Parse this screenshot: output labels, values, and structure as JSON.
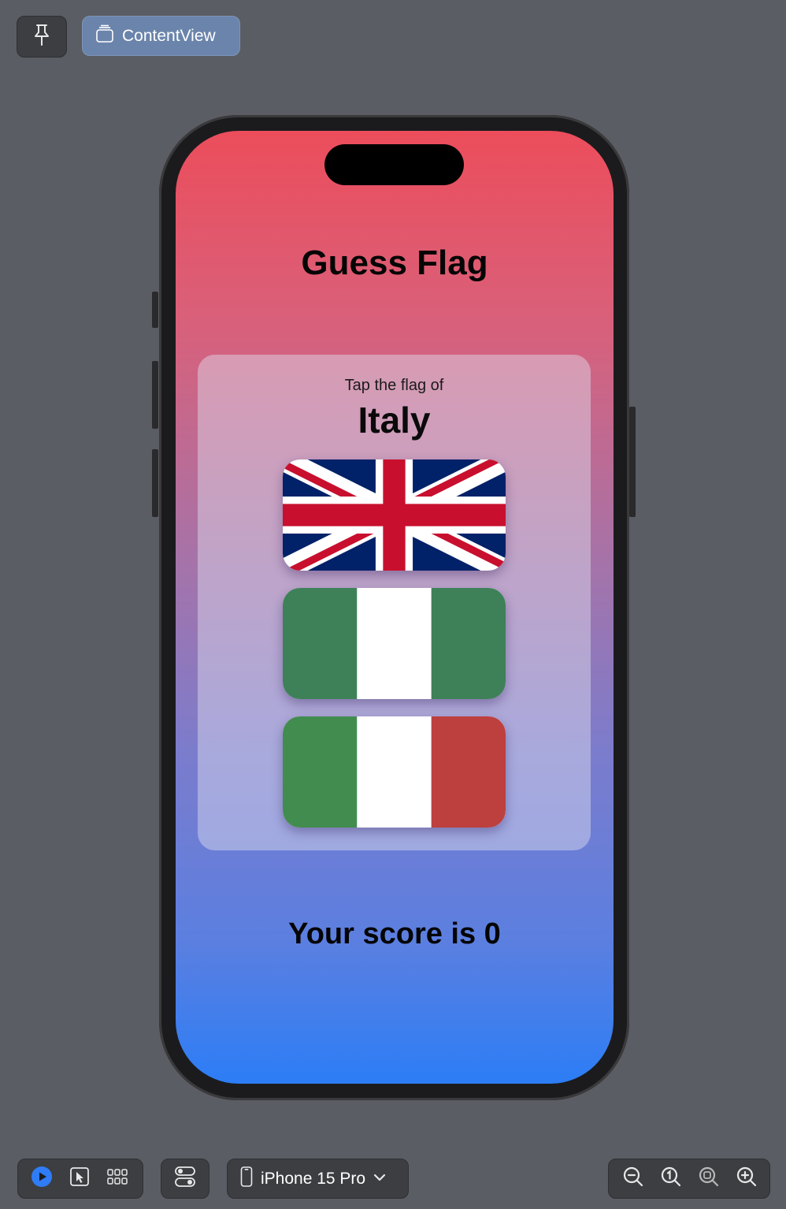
{
  "toolbar": {
    "preview_label": "ContentView"
  },
  "app": {
    "title": "Guess Flag",
    "prompt": "Tap the flag of",
    "country": "Italy",
    "flags": [
      {
        "icon": "uk-flag"
      },
      {
        "icon": "nigeria-flag"
      },
      {
        "icon": "italy-flag"
      }
    ],
    "score_text": "Your score is 0"
  },
  "bottom_toolbar": {
    "device_name": "iPhone 15 Pro"
  },
  "colors": {
    "gradient_top": "#ec4d5b",
    "gradient_bottom": "#2c7df6",
    "accent_blue": "#2f7cf6"
  }
}
